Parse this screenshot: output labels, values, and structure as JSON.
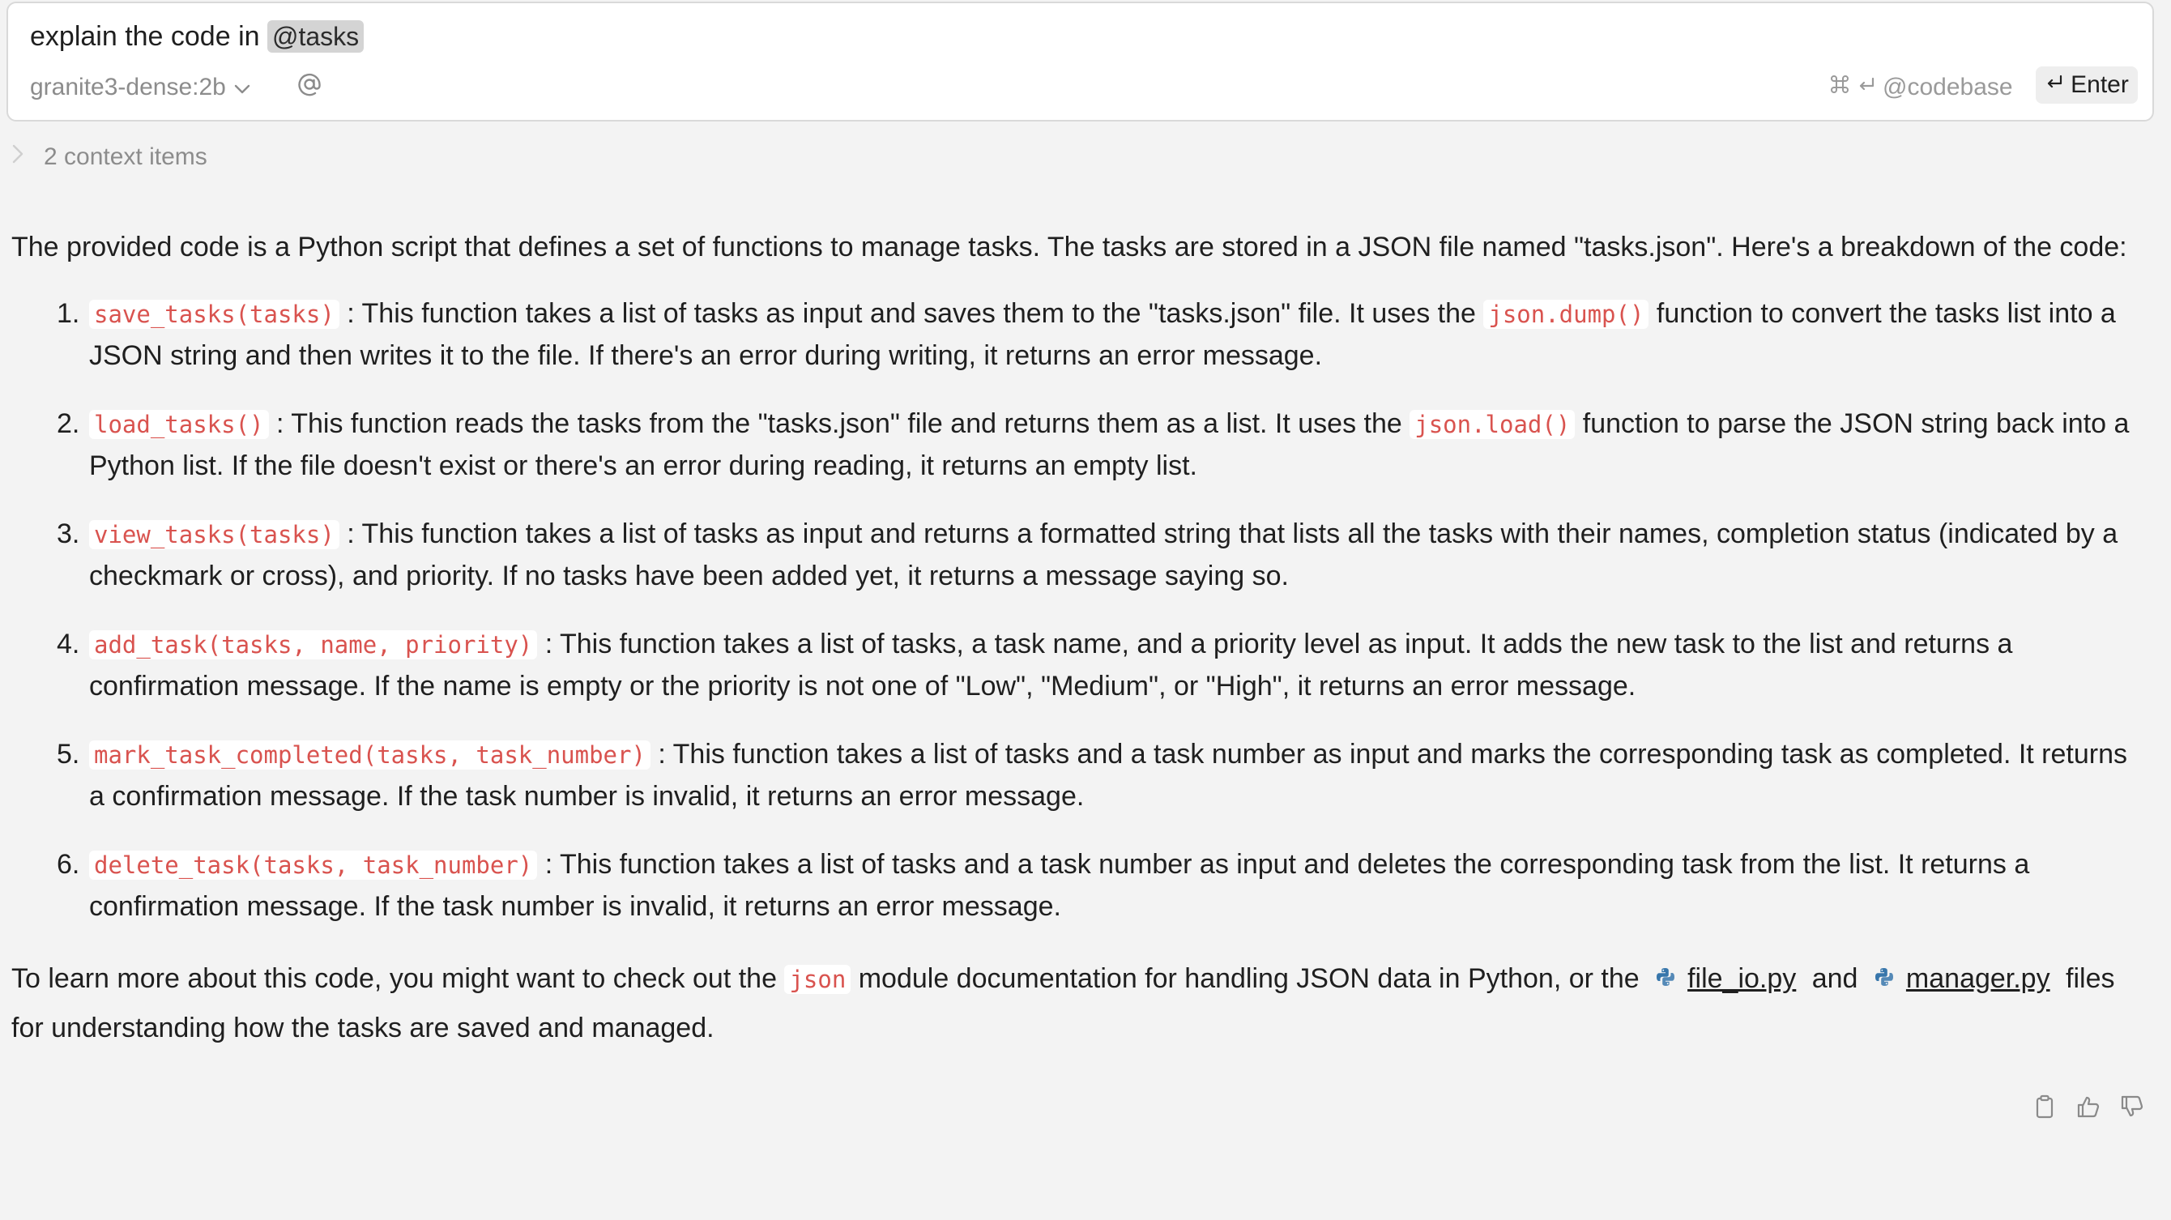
{
  "prompt": {
    "text": "explain the code in ",
    "mention": "@tasks"
  },
  "toolbar": {
    "model": "granite3-dense:2b",
    "codebase_hint": "@codebase",
    "enter_label": "Enter"
  },
  "context": {
    "label": "2 context items"
  },
  "answer": {
    "intro": "The provided code is a Python script that defines a set of functions to manage tasks. The tasks are stored in a JSON file named \"tasks.json\". Here's a breakdown of the code:",
    "items": [
      {
        "num": "1.",
        "code": "save_tasks(tasks)",
        "text_a": " : This function takes a list of tasks as input and saves them to the \"tasks.json\" file. It uses the ",
        "code2": "json.dump()",
        "text_b": " function to convert the tasks list into a JSON string and then writes it to the file. If there's an error during writing, it returns an error message."
      },
      {
        "num": "2.",
        "code": "load_tasks()",
        "text_a": " : This function reads the tasks from the \"tasks.json\" file and returns them as a list. It uses the ",
        "code2": "json.load()",
        "text_b": " function to parse the JSON string back into a Python list. If the file doesn't exist or there's an error during reading, it returns an empty list."
      },
      {
        "num": "3.",
        "code": "view_tasks(tasks)",
        "text_a": " : This function takes a list of tasks as input and returns a formatted string that lists all the tasks with their names, completion status (indicated by a checkmark or cross), and priority. If no tasks have been added yet, it returns a message saying so."
      },
      {
        "num": "4.",
        "code": "add_task(tasks, name, priority)",
        "text_a": " : This function takes a list of tasks, a task name, and a priority level as input. It adds the new task to the list and returns a confirmation message. If the name is empty or the priority is not one of \"Low\", \"Medium\", or \"High\", it returns an error message."
      },
      {
        "num": "5.",
        "code": "mark_task_completed(tasks, task_number)",
        "text_a": " : This function takes a list of tasks and a task number as input and marks the corresponding task as completed. It returns a confirmation message. If the task number is invalid, it returns an error message."
      },
      {
        "num": "6.",
        "code": "delete_task(tasks, task_number)",
        "text_a": " : This function takes a list of tasks and a task number as input and deletes the corresponding task from the list. It returns a confirmation message. If the task number is invalid, it returns an error message."
      }
    ],
    "outro": {
      "pre": "To learn more about this code, you might want to check out the ",
      "code": "json",
      "mid": " module documentation for handling JSON data in Python, or the ",
      "file1": "file_io.py",
      "and": " and ",
      "file2": "manager.py",
      "post": " files for understanding how the tasks are saved and managed."
    }
  },
  "feedback": {
    "icons": [
      "clipboard-icon",
      "thumbs-up-icon",
      "thumbs-down-icon"
    ]
  },
  "colors": {
    "background": "#f3f3f3",
    "code_text": "#d9534f",
    "python_blue": "#3776ab",
    "python_yellow": "#ffd43b"
  }
}
